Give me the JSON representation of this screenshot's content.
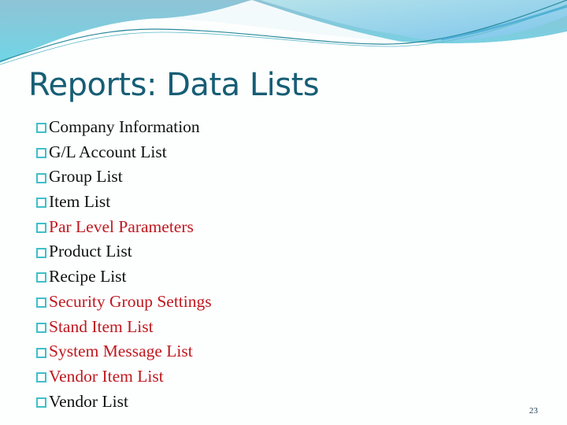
{
  "slide": {
    "title": "Reports: Data Lists",
    "page_number": "23",
    "colors": {
      "title": "#165e75",
      "text_default": "#111111",
      "text_highlight": "#c0181f",
      "bullet": "#3fbfca"
    },
    "items": [
      {
        "label": "Company Information",
        "highlighted": false
      },
      {
        "label": "G/L Account List",
        "highlighted": false
      },
      {
        "label": "Group List",
        "highlighted": false
      },
      {
        "label": "Item List",
        "highlighted": false
      },
      {
        "label": "Par Level Parameters",
        "highlighted": true
      },
      {
        "label": "Product List",
        "highlighted": false
      },
      {
        "label": "Recipe List",
        "highlighted": false
      },
      {
        "label": "Security Group Settings",
        "highlighted": true
      },
      {
        "label": "Stand Item List",
        "highlighted": true
      },
      {
        "label": "System Message List",
        "highlighted": true
      },
      {
        "label": "Vendor Item List",
        "highlighted": true
      },
      {
        "label": "Vendor List",
        "highlighted": false
      }
    ]
  }
}
